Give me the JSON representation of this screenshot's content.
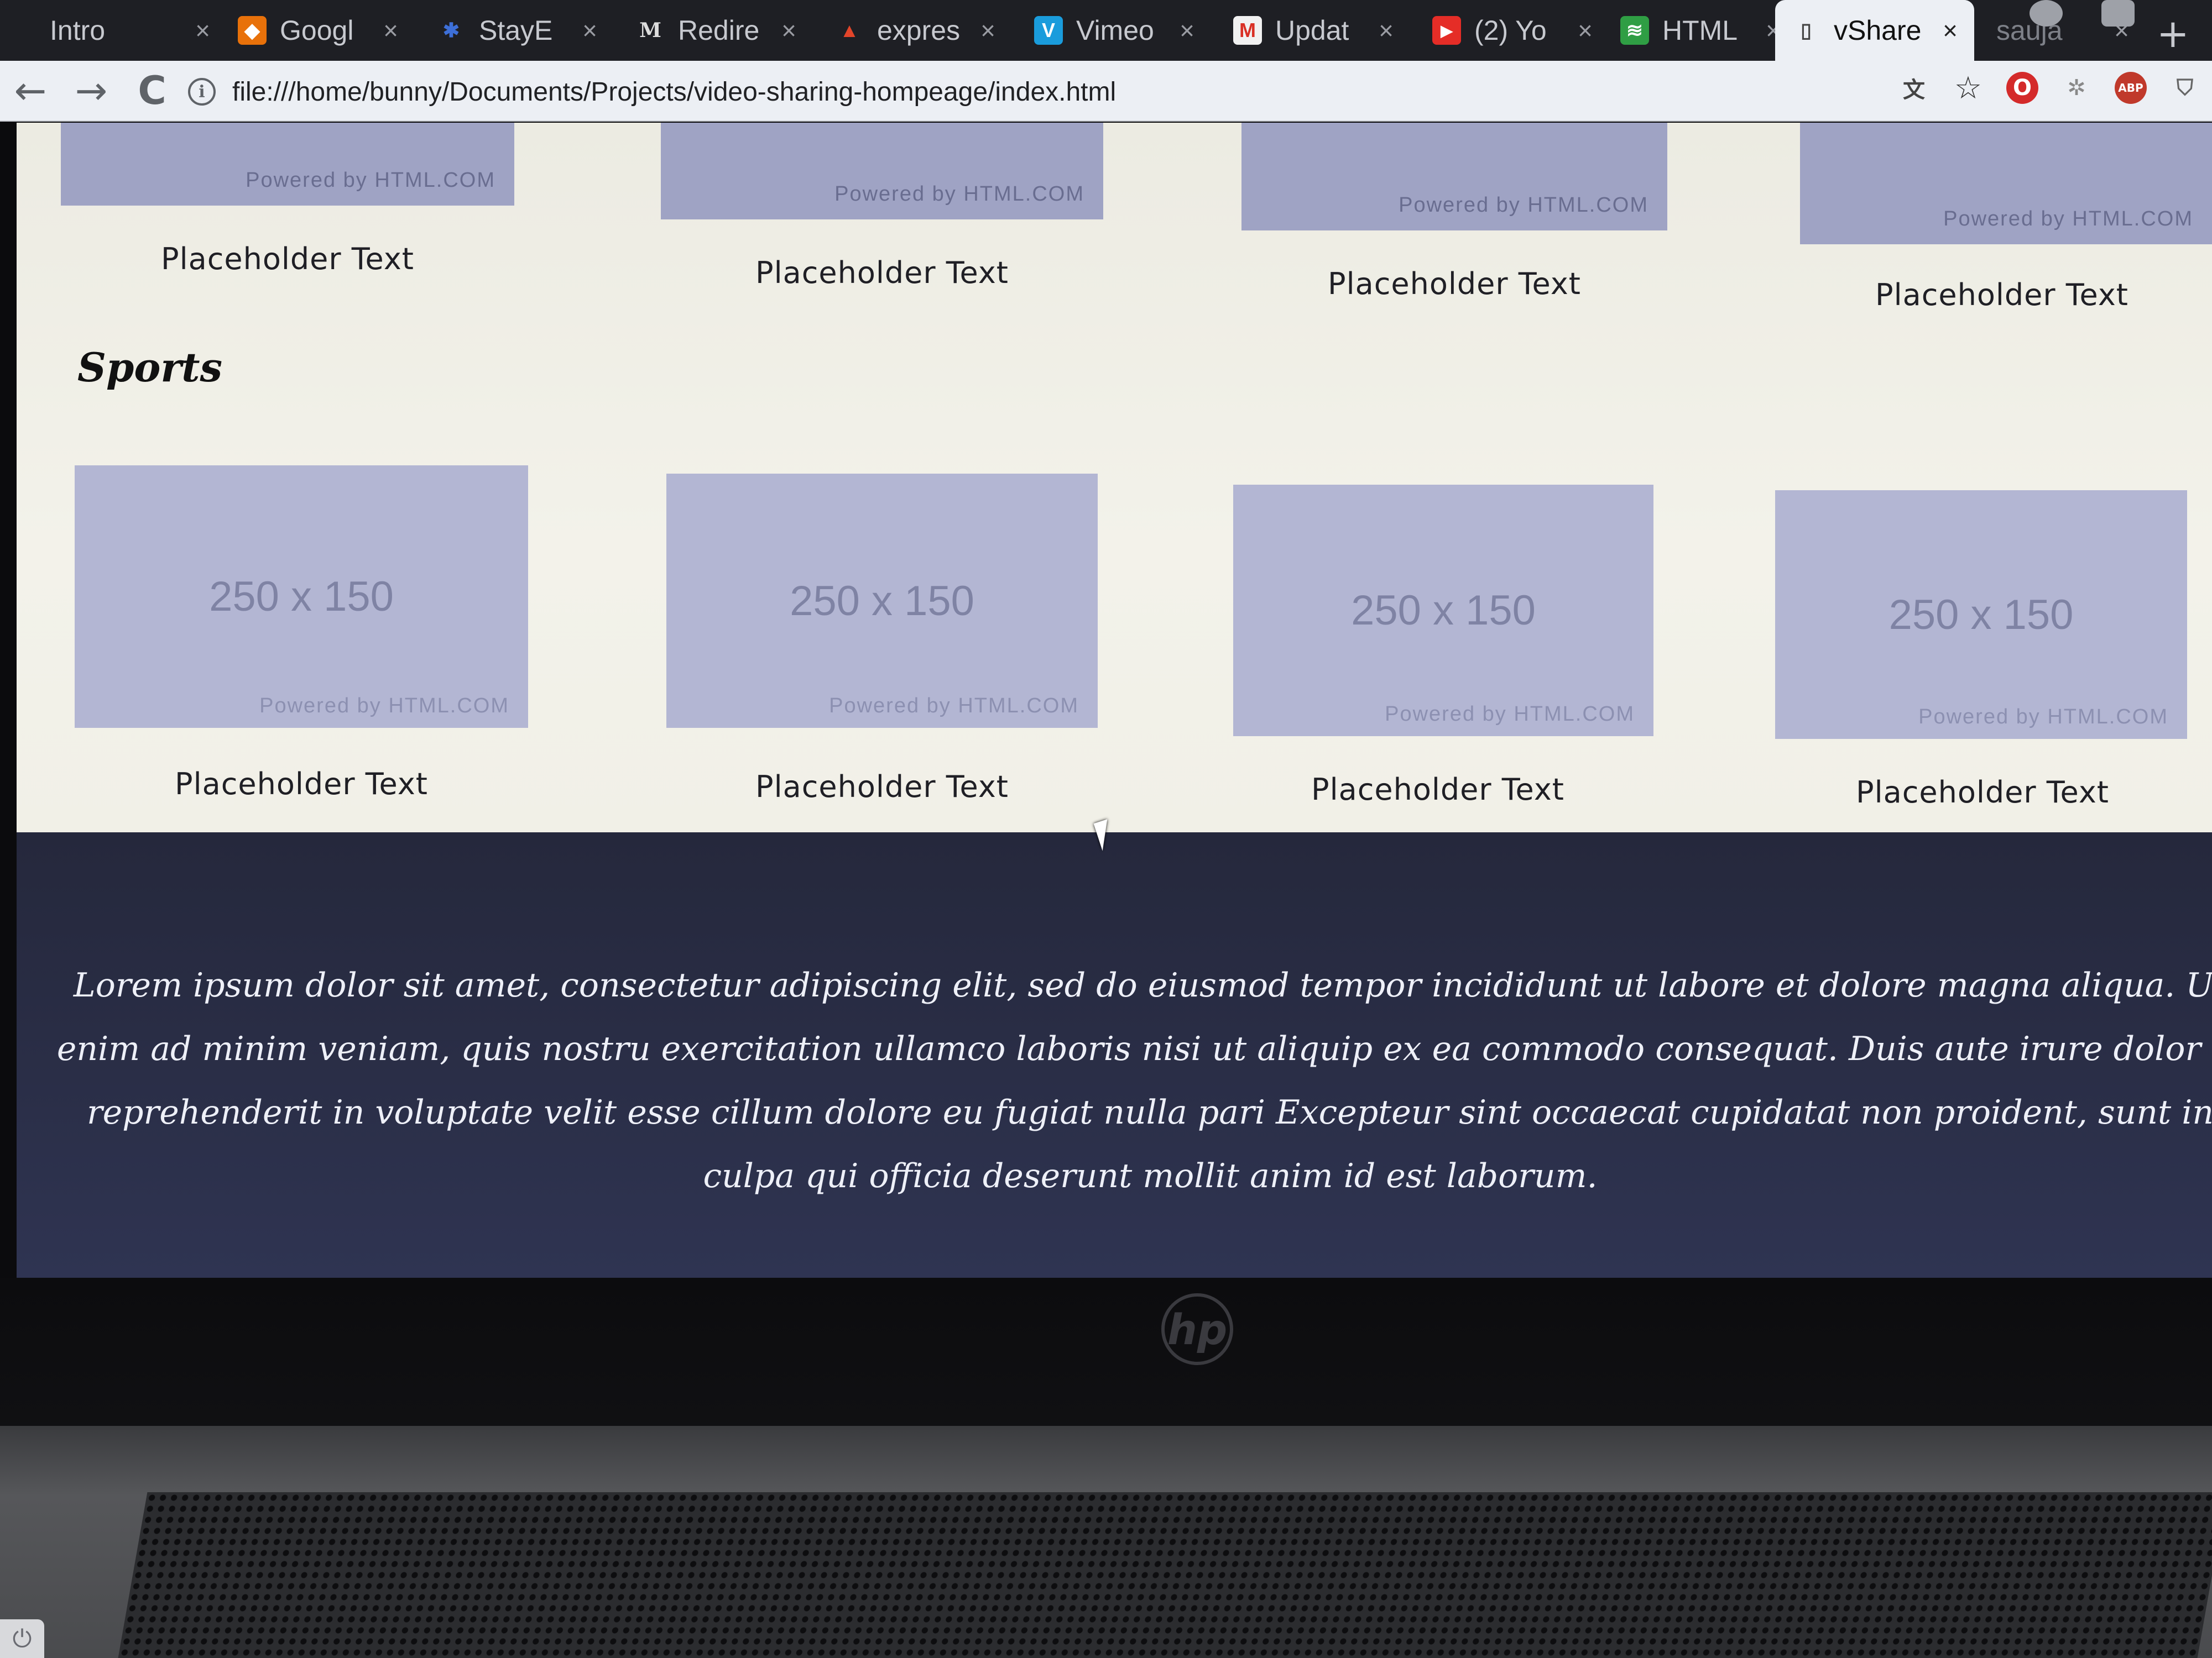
{
  "browser": {
    "tabs": [
      {
        "title": "Intro",
        "favicon": ""
      },
      {
        "title": "Googl",
        "favicon": "◆"
      },
      {
        "title": "StayE",
        "favicon": "✱"
      },
      {
        "title": "Redire",
        "favicon": "M"
      },
      {
        "title": "expres",
        "favicon": "▲"
      },
      {
        "title": "Vimeo",
        "favicon": "V"
      },
      {
        "title": "Updat",
        "favicon": "M"
      },
      {
        "title": "(2) Yo",
        "favicon": "▶"
      },
      {
        "title": "HTML",
        "favicon": "≋"
      },
      {
        "title": "vShare",
        "favicon": "▯",
        "active": true
      },
      {
        "title": "sauja",
        "favicon": ""
      }
    ],
    "tab_close_glyph": "×",
    "new_tab_glyph": "+",
    "address": "file:///home/bunny/Documents/Projects/video-sharing-hompeage/index.html",
    "nav": {
      "back": "←",
      "forward": "→",
      "reload": "C"
    },
    "toolbar_icons": [
      "translate-icon",
      "star-icon",
      "opera-icon",
      "settings-extension-icon",
      "adblock-icon",
      "shield-icon"
    ],
    "toolbar_glyphs": {
      "translate": "文",
      "star": "☆",
      "opera": "O",
      "settings": "✲",
      "adblock": "ABP",
      "shield": "⛉"
    }
  },
  "page": {
    "top_row": [
      {
        "powered": "Powered by HTML.COM",
        "caption": "Placeholder Text"
      },
      {
        "powered": "Powered by HTML.COM",
        "caption": "Placeholder Text"
      },
      {
        "powered": "Powered by HTML.COM",
        "caption": "Placeholder Text"
      },
      {
        "powered": "Powered by HTML.COM",
        "caption": "Placeholder Text"
      }
    ],
    "section_title": "Sports",
    "sports_row": [
      {
        "dims": "250 x 150",
        "powered": "Powered by HTML.COM",
        "caption": "Placeholder Text"
      },
      {
        "dims": "250 x 150",
        "powered": "Powered by HTML.COM",
        "caption": "Placeholder Text"
      },
      {
        "dims": "250 x 150",
        "powered": "Powered by HTML.COM",
        "caption": "Placeholder Text"
      },
      {
        "dims": "250 x 150",
        "powered": "Powered by HTML.COM",
        "caption": "Placeholder Text"
      }
    ],
    "footer_text": "Lorem ipsum dolor sit amet, consectetur adipiscing elit, sed do eiusmod tempor incididunt ut labore et dolore magna aliqua. Ut enim ad minim veniam, quis nostru exercitation ullamco laboris nisi ut aliquip ex ea commodo consequat. Duis aute irure dolor in reprehenderit in voluptate velit esse cillum dolore eu fugiat nulla pari Excepteur sint occaecat cupidatat non proident, sunt in culpa qui officia deserunt mollit anim id est laborum."
  },
  "hardware": {
    "logo": "hp",
    "power_glyph": "⏻"
  },
  "colors": {
    "thumb": "#b3b6d3",
    "page_bg": "#f1f0e7",
    "footer_bg": "#2a2e47",
    "tab_active": "#eceff4",
    "tabstrip": "#1e1f24"
  }
}
